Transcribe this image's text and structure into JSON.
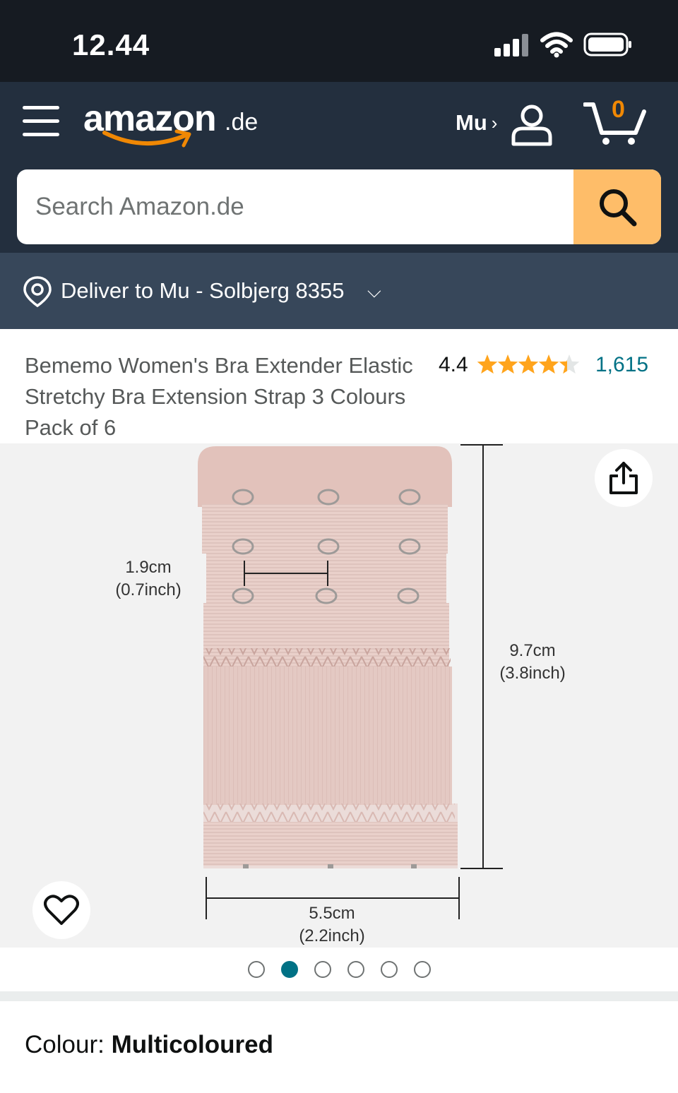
{
  "status_bar": {
    "time": "12.44",
    "icons": [
      "signal-icon",
      "wifi-icon",
      "battery-icon"
    ]
  },
  "header": {
    "logo_text": "amazon",
    "logo_tld": ".de",
    "account_name": "Mu",
    "account_chevron": "›",
    "cart_count": "0",
    "icons": [
      "menu-icon",
      "user-icon",
      "cart-icon"
    ]
  },
  "search": {
    "placeholder": "Search Amazon.de",
    "value": ""
  },
  "delivery": {
    "text": "Deliver to Mu - Solbjerg 8355",
    "chevron": "⌵"
  },
  "product": {
    "title": "Bememo Women's Bra Extender Elastic Stretchy Bra Extension Strap 3 Colours Pack of 6",
    "rating": "4.4",
    "rating_stars": 4.4,
    "rating_count": "1,615"
  },
  "image": {
    "label_hook_spacing_cm": "1.9cm",
    "label_hook_spacing_in": "(0.7inch)",
    "label_height_cm": "9.7cm",
    "label_height_in": "(3.8inch)",
    "label_width_cm": "5.5cm",
    "label_width_in": "(2.2inch)",
    "gallery_total": 6,
    "gallery_active": 2
  },
  "colour": {
    "label": "Colour: ",
    "value": "Multicoloured"
  },
  "colors": {
    "status_bar": "#161b22",
    "header": "#232f3e",
    "delivery_bar": "#37475a",
    "search_button": "#febd69",
    "rating_star": "#ffa41c",
    "link": "#007185",
    "cart_count": "#f08804"
  }
}
